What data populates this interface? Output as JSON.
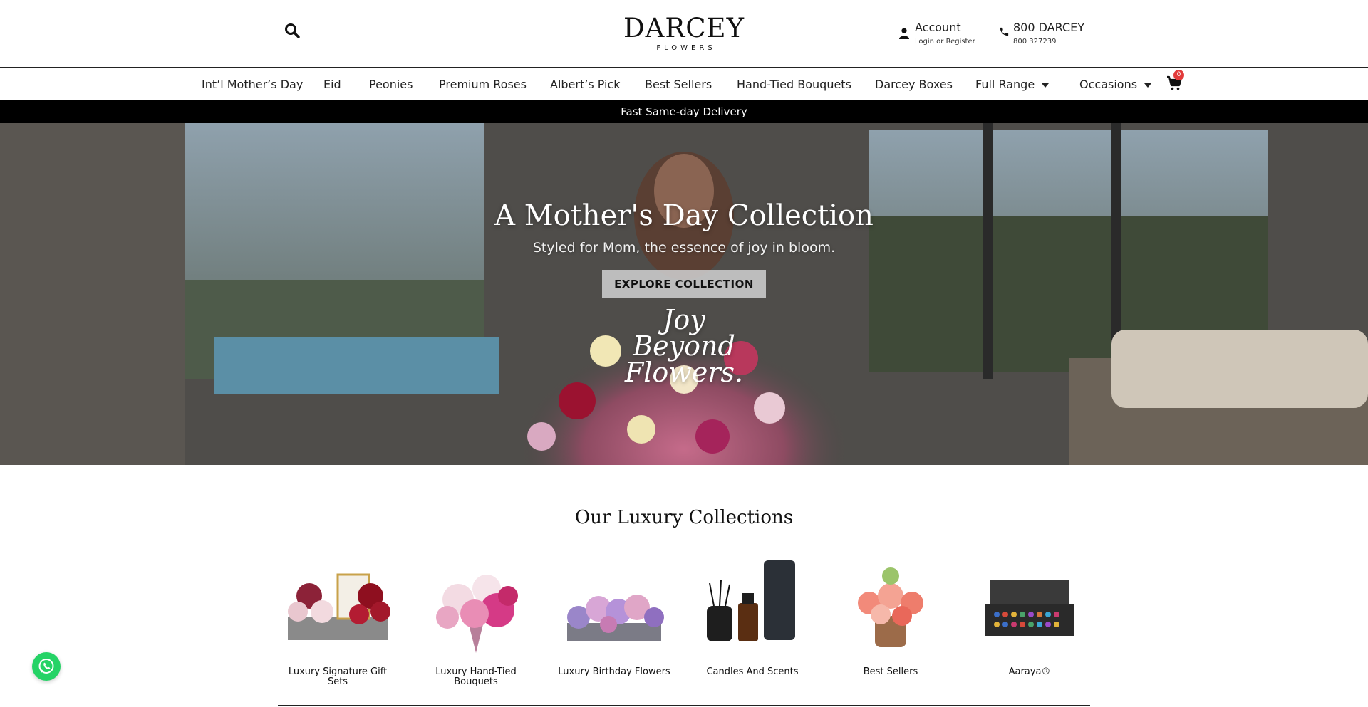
{
  "header": {
    "logo_main": "DARCEY",
    "logo_sub": "FLOWERS",
    "account_title": "Account",
    "account_sub": "Login or Register",
    "phone_title": "800 DARCEY",
    "phone_sub": "800 327239"
  },
  "nav": {
    "items": [
      "Int’l Mother’s Day",
      "Eid",
      "Peonies",
      "Premium Roses",
      "Albert’s Pick",
      "Best Sellers",
      "Hand-Tied Bouquets",
      "Darcey Boxes",
      "Full Range",
      "Occasions"
    ],
    "cart_count": "0"
  },
  "banner": {
    "text": "Fast Same-day Delivery"
  },
  "hero": {
    "title": "A Mother's Day Collection",
    "subtitle": "Styled for Mom, the essence of joy in bloom.",
    "button": "EXPLORE COLLECTION",
    "tagline_1": "Joy",
    "tagline_2": "Beyond",
    "tagline_3": "Flowers."
  },
  "collections": {
    "title": "Our Luxury Collections",
    "items": [
      "Luxury Signature Gift Sets",
      "Luxury Hand-Tied Bouquets",
      "Luxury Birthday Flowers",
      "Candles And Scents",
      "Best Sellers",
      "Aaraya®"
    ]
  },
  "colors": {
    "text": "#111111",
    "banner_bg": "#000000",
    "badge": "#e23b3b",
    "whatsapp": "#25d366"
  }
}
